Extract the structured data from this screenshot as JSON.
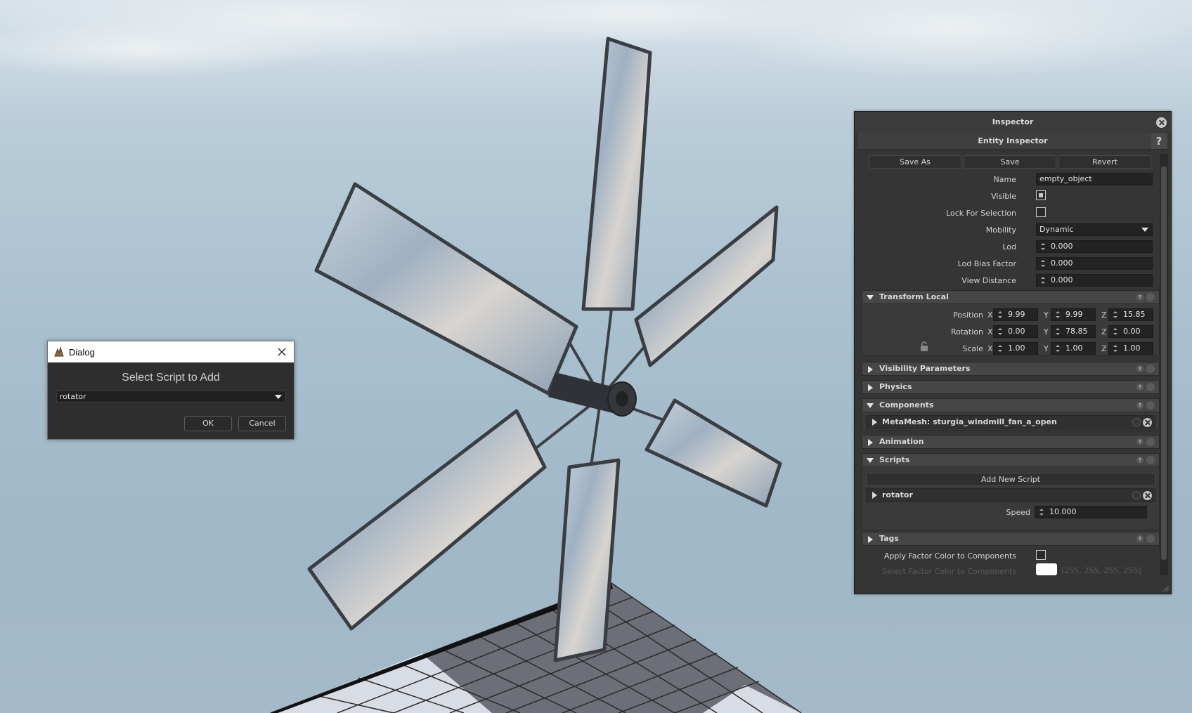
{
  "dialog": {
    "title": "Dialog",
    "heading": "Select Script to Add",
    "selected_script": "rotator",
    "ok_label": "OK",
    "cancel_label": "Cancel"
  },
  "inspector": {
    "title": "Inspector",
    "entity_title": "Entity Inspector",
    "help_label": "?",
    "buttons": {
      "save_as": "Save As",
      "save": "Save",
      "revert": "Revert"
    },
    "name_label": "Name",
    "name_value": "empty_object",
    "visible_label": "Visible",
    "visible_checked": true,
    "lock_label": "Lock For Selection",
    "lock_checked": false,
    "mobility_label": "Mobility",
    "mobility_value": "Dynamic",
    "lod_label": "Lod",
    "lod_value": "0.000",
    "lod_bias_label": "Lod Bias Factor",
    "lod_bias_value": "0.000",
    "view_distance_label": "View Distance",
    "view_distance_value": "0.000",
    "transform": {
      "title": "Transform Local",
      "position_label": "Position",
      "rotation_label": "Rotation",
      "scale_label": "Scale",
      "axis_x": "X",
      "axis_y": "Y",
      "axis_z": "Z",
      "position": [
        "9.99",
        "9.99",
        "15.85"
      ],
      "rotation": [
        "0.00",
        "78.85",
        "0.00"
      ],
      "scale": [
        "1.00",
        "1.00",
        "1.00"
      ]
    },
    "sections": {
      "visibility": "Visibility Parameters",
      "physics": "Physics",
      "components": "Components",
      "animation": "Animation",
      "scripts": "Scripts",
      "tags": "Tags"
    },
    "component_item": "MetaMesh: sturgia_windmill_fan_a_open",
    "add_script_label": "Add New Script",
    "script_item": "rotator",
    "speed_label": "Speed",
    "speed_value": "10.000",
    "apply_factor_label": "Apply Factor Color to Components",
    "select_factor_label": "Select Factor Color to Components",
    "factor_color_value": "[255, 255, 255, 255]"
  },
  "colors": {
    "panel_bg": "#353535",
    "section_bg": "#464646",
    "field_bg": "#232323",
    "sky": "#a9c0cf"
  }
}
